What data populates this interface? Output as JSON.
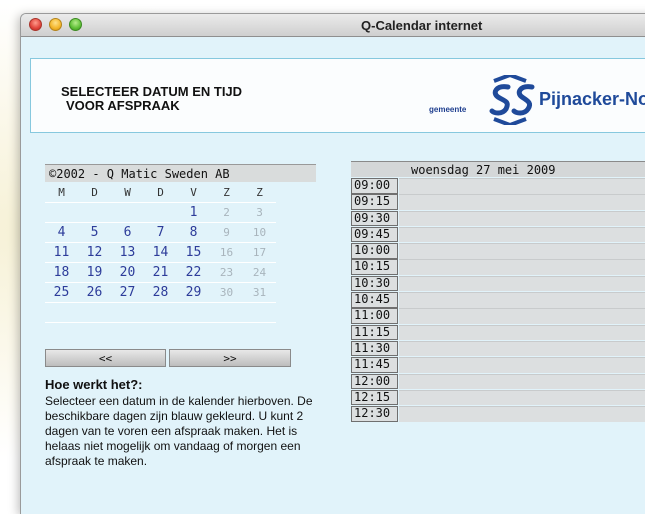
{
  "window": {
    "title": "Q-Calendar internet"
  },
  "header": {
    "title_line1": "SELECTEER DATUM EN TIJD",
    "title_line2": "VOOR AFSPRAAK",
    "logo_prefix": "gemeente",
    "logo_name": "Pijnacker-No"
  },
  "calendar": {
    "copyright": "©2002 - Q Matic Sweden AB",
    "weekdays": [
      "M",
      "D",
      "W",
      "D",
      "V",
      "Z",
      "Z"
    ],
    "weeks": [
      [
        {
          "d": ""
        },
        {
          "d": ""
        },
        {
          "d": ""
        },
        {
          "d": ""
        },
        {
          "d": "1",
          "a": true
        },
        {
          "d": "2",
          "a": false
        },
        {
          "d": "3",
          "a": false
        }
      ],
      [
        {
          "d": "4",
          "a": true
        },
        {
          "d": "5",
          "a": true
        },
        {
          "d": "6",
          "a": true
        },
        {
          "d": "7",
          "a": true
        },
        {
          "d": "8",
          "a": true
        },
        {
          "d": "9",
          "a": false
        },
        {
          "d": "10",
          "a": false
        }
      ],
      [
        {
          "d": "11",
          "a": true
        },
        {
          "d": "12",
          "a": true
        },
        {
          "d": "13",
          "a": true
        },
        {
          "d": "14",
          "a": true
        },
        {
          "d": "15",
          "a": true
        },
        {
          "d": "16",
          "a": false
        },
        {
          "d": "17",
          "a": false
        }
      ],
      [
        {
          "d": "18",
          "a": true
        },
        {
          "d": "19",
          "a": true
        },
        {
          "d": "20",
          "a": true
        },
        {
          "d": "21",
          "a": true
        },
        {
          "d": "22",
          "a": true
        },
        {
          "d": "23",
          "a": false
        },
        {
          "d": "24",
          "a": false
        }
      ],
      [
        {
          "d": "25",
          "a": true
        },
        {
          "d": "26",
          "a": true
        },
        {
          "d": "27",
          "a": true
        },
        {
          "d": "28",
          "a": true
        },
        {
          "d": "29",
          "a": true
        },
        {
          "d": "30",
          "a": false
        },
        {
          "d": "31",
          "a": false
        }
      ],
      [
        {
          "d": ""
        },
        {
          "d": ""
        },
        {
          "d": ""
        },
        {
          "d": ""
        },
        {
          "d": ""
        },
        {
          "d": ""
        },
        {
          "d": ""
        }
      ]
    ],
    "prev_label": "<<",
    "next_label": ">>"
  },
  "help": {
    "title": "Hoe werkt het?:",
    "text": "Selecteer een datum in de kalender hierboven. De beschikbare dagen zijn blauw gekleurd. U kunt 2 dagen van te voren een afspraak maken. Het is helaas niet mogelijk om vandaag of morgen een afspraak te maken."
  },
  "day": {
    "title": "woensdag 27 mei 2009",
    "slots": [
      "09:00",
      "09:15",
      "09:30",
      "09:45",
      "10:00",
      "10:15",
      "10:30",
      "10:45",
      "11:00",
      "11:15",
      "11:30",
      "11:45",
      "12:00",
      "12:15",
      "12:30"
    ]
  },
  "colors": {
    "available": "#2d3c9a",
    "unavailable": "#a8b4bc",
    "panel": "#e1f3fa"
  }
}
